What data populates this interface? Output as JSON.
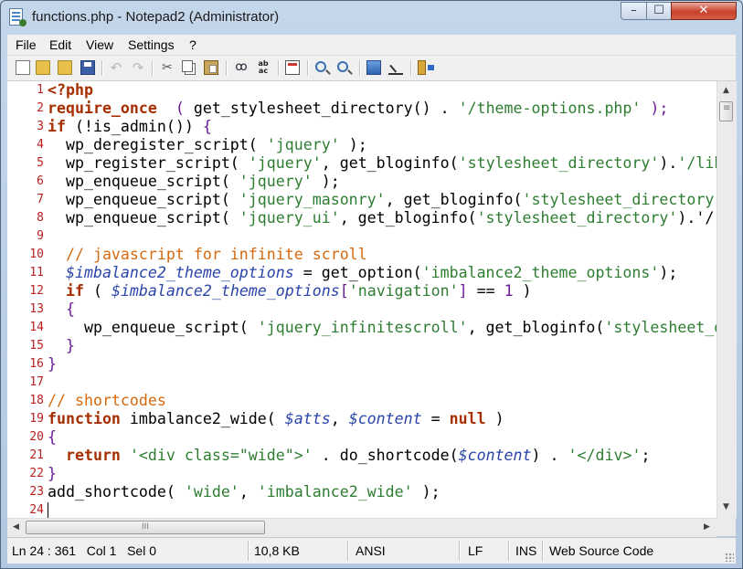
{
  "window": {
    "title": "functions.php - Notepad2 (Administrator)",
    "buttons": {
      "minimize": "–",
      "maximize": "☐",
      "close": "✕"
    }
  },
  "menu": [
    "File",
    "Edit",
    "View",
    "Settings",
    "?"
  ],
  "toolbar": [
    "new-icon",
    "open-icon",
    "browse-icon",
    "save-icon",
    "undo-icon",
    "redo-icon",
    "cut-icon",
    "copy-icon",
    "paste-icon",
    "find-icon",
    "replace-icon",
    "word-wrap-icon",
    "zoom-in-icon",
    "zoom-out-icon",
    "scheme-icon",
    "customize-icon",
    "exit-icon"
  ],
  "editor": {
    "current_line": 24,
    "lines": [
      [
        [
          "kw",
          "<?php"
        ]
      ],
      [
        [
          "kw",
          "require_once"
        ],
        [
          "",
          "  "
        ],
        [
          "op",
          "("
        ],
        [
          "",
          " get_stylesheet_directory() . "
        ],
        [
          "st",
          "'/theme-options.php'"
        ],
        [
          "",
          " "
        ],
        [
          "op",
          ");"
        ]
      ],
      [
        [
          "kw",
          "if"
        ],
        [
          "",
          " (!is_admin()) "
        ],
        [
          "op",
          "{"
        ]
      ],
      [
        [
          "",
          "  wp_deregister_script( "
        ],
        [
          "st",
          "'jquery'"
        ],
        [
          "",
          " );"
        ]
      ],
      [
        [
          "",
          "  wp_register_script( "
        ],
        [
          "st",
          "'jquery'"
        ],
        [
          "",
          ", get_bloginfo("
        ],
        [
          "st",
          "'stylesheet_directory'"
        ],
        [
          "",
          ")."
        ],
        [
          "st",
          "'/lib"
        ]
      ],
      [
        [
          "",
          "  wp_enqueue_script( "
        ],
        [
          "st",
          "'jquery'"
        ],
        [
          "",
          " );"
        ]
      ],
      [
        [
          "",
          "  wp_enqueue_script( "
        ],
        [
          "st",
          "'jquery_masonry'"
        ],
        [
          "",
          ", get_bloginfo("
        ],
        [
          "st",
          "'stylesheet_directory"
        ]
      ],
      [
        [
          "",
          "  wp_enqueue_script( "
        ],
        [
          "st",
          "'jquery_ui'"
        ],
        [
          "",
          ", get_bloginfo("
        ],
        [
          "st",
          "'stylesheet_directory'"
        ],
        [
          "",
          ").'/"
        ]
      ],
      [],
      [
        [
          "",
          "  "
        ],
        [
          "cm",
          "// javascript for infinite scroll"
        ]
      ],
      [
        [
          "",
          "  "
        ],
        [
          "va",
          "$imbalance2_theme_options"
        ],
        [
          "",
          " = get_option("
        ],
        [
          "st",
          "'imbalance2_theme_options'"
        ],
        [
          "",
          ");"
        ]
      ],
      [
        [
          "",
          "  "
        ],
        [
          "kw",
          "if"
        ],
        [
          "",
          " ( "
        ],
        [
          "va",
          "$imbalance2_theme_options"
        ],
        [
          "op",
          "["
        ],
        [
          "st",
          "'navigation'"
        ],
        [
          "op",
          "]"
        ],
        [
          "",
          " == "
        ],
        [
          "op",
          "1"
        ],
        [
          "",
          " )"
        ]
      ],
      [
        [
          "",
          "  "
        ],
        [
          "op",
          "{"
        ]
      ],
      [
        [
          "",
          "    wp_enqueue_script( "
        ],
        [
          "st",
          "'jquery_infinitescroll'"
        ],
        [
          "",
          ", get_bloginfo("
        ],
        [
          "st",
          "'stylesheet_d"
        ]
      ],
      [
        [
          "",
          "  "
        ],
        [
          "op",
          "}"
        ]
      ],
      [
        [
          "op",
          "}"
        ]
      ],
      [],
      [
        [
          "cm",
          "// shortcodes"
        ]
      ],
      [
        [
          "kw",
          "function"
        ],
        [
          "",
          " imbalance2_wide( "
        ],
        [
          "va",
          "$atts"
        ],
        [
          "",
          ", "
        ],
        [
          "va",
          "$content"
        ],
        [
          "",
          " = "
        ],
        [
          "kw",
          "null"
        ],
        [
          "",
          " )"
        ]
      ],
      [
        [
          "op",
          "{"
        ]
      ],
      [
        [
          "",
          "  "
        ],
        [
          "kw",
          "return"
        ],
        [
          "",
          " "
        ],
        [
          "st",
          "'<div class=\"wide\">'"
        ],
        [
          "",
          " . do_shortcode("
        ],
        [
          "va",
          "$content"
        ],
        [
          "",
          ") . "
        ],
        [
          "st",
          "'</div>'"
        ],
        [
          "",
          ";"
        ]
      ],
      [
        [
          "op",
          "}"
        ]
      ],
      [
        [
          "",
          "add_shortcode( "
        ],
        [
          "st",
          "'wide'"
        ],
        [
          "",
          ", "
        ],
        [
          "st",
          "'imbalance2_wide'"
        ],
        [
          "",
          " );"
        ]
      ],
      []
    ]
  },
  "hscroll": {
    "thumb_label": "III",
    "left_arrow": "◀",
    "right_arrow": "▶"
  },
  "vscroll": {
    "up_arrow": "▲",
    "down_arrow": "▼"
  },
  "status": {
    "position": "Ln 24 : 361   Col 1   Sel 0",
    "size": "10,8 KB",
    "encoding": "ANSI",
    "line_endings": "LF",
    "insert_mode": "INS",
    "scheme": "Web Source Code"
  }
}
